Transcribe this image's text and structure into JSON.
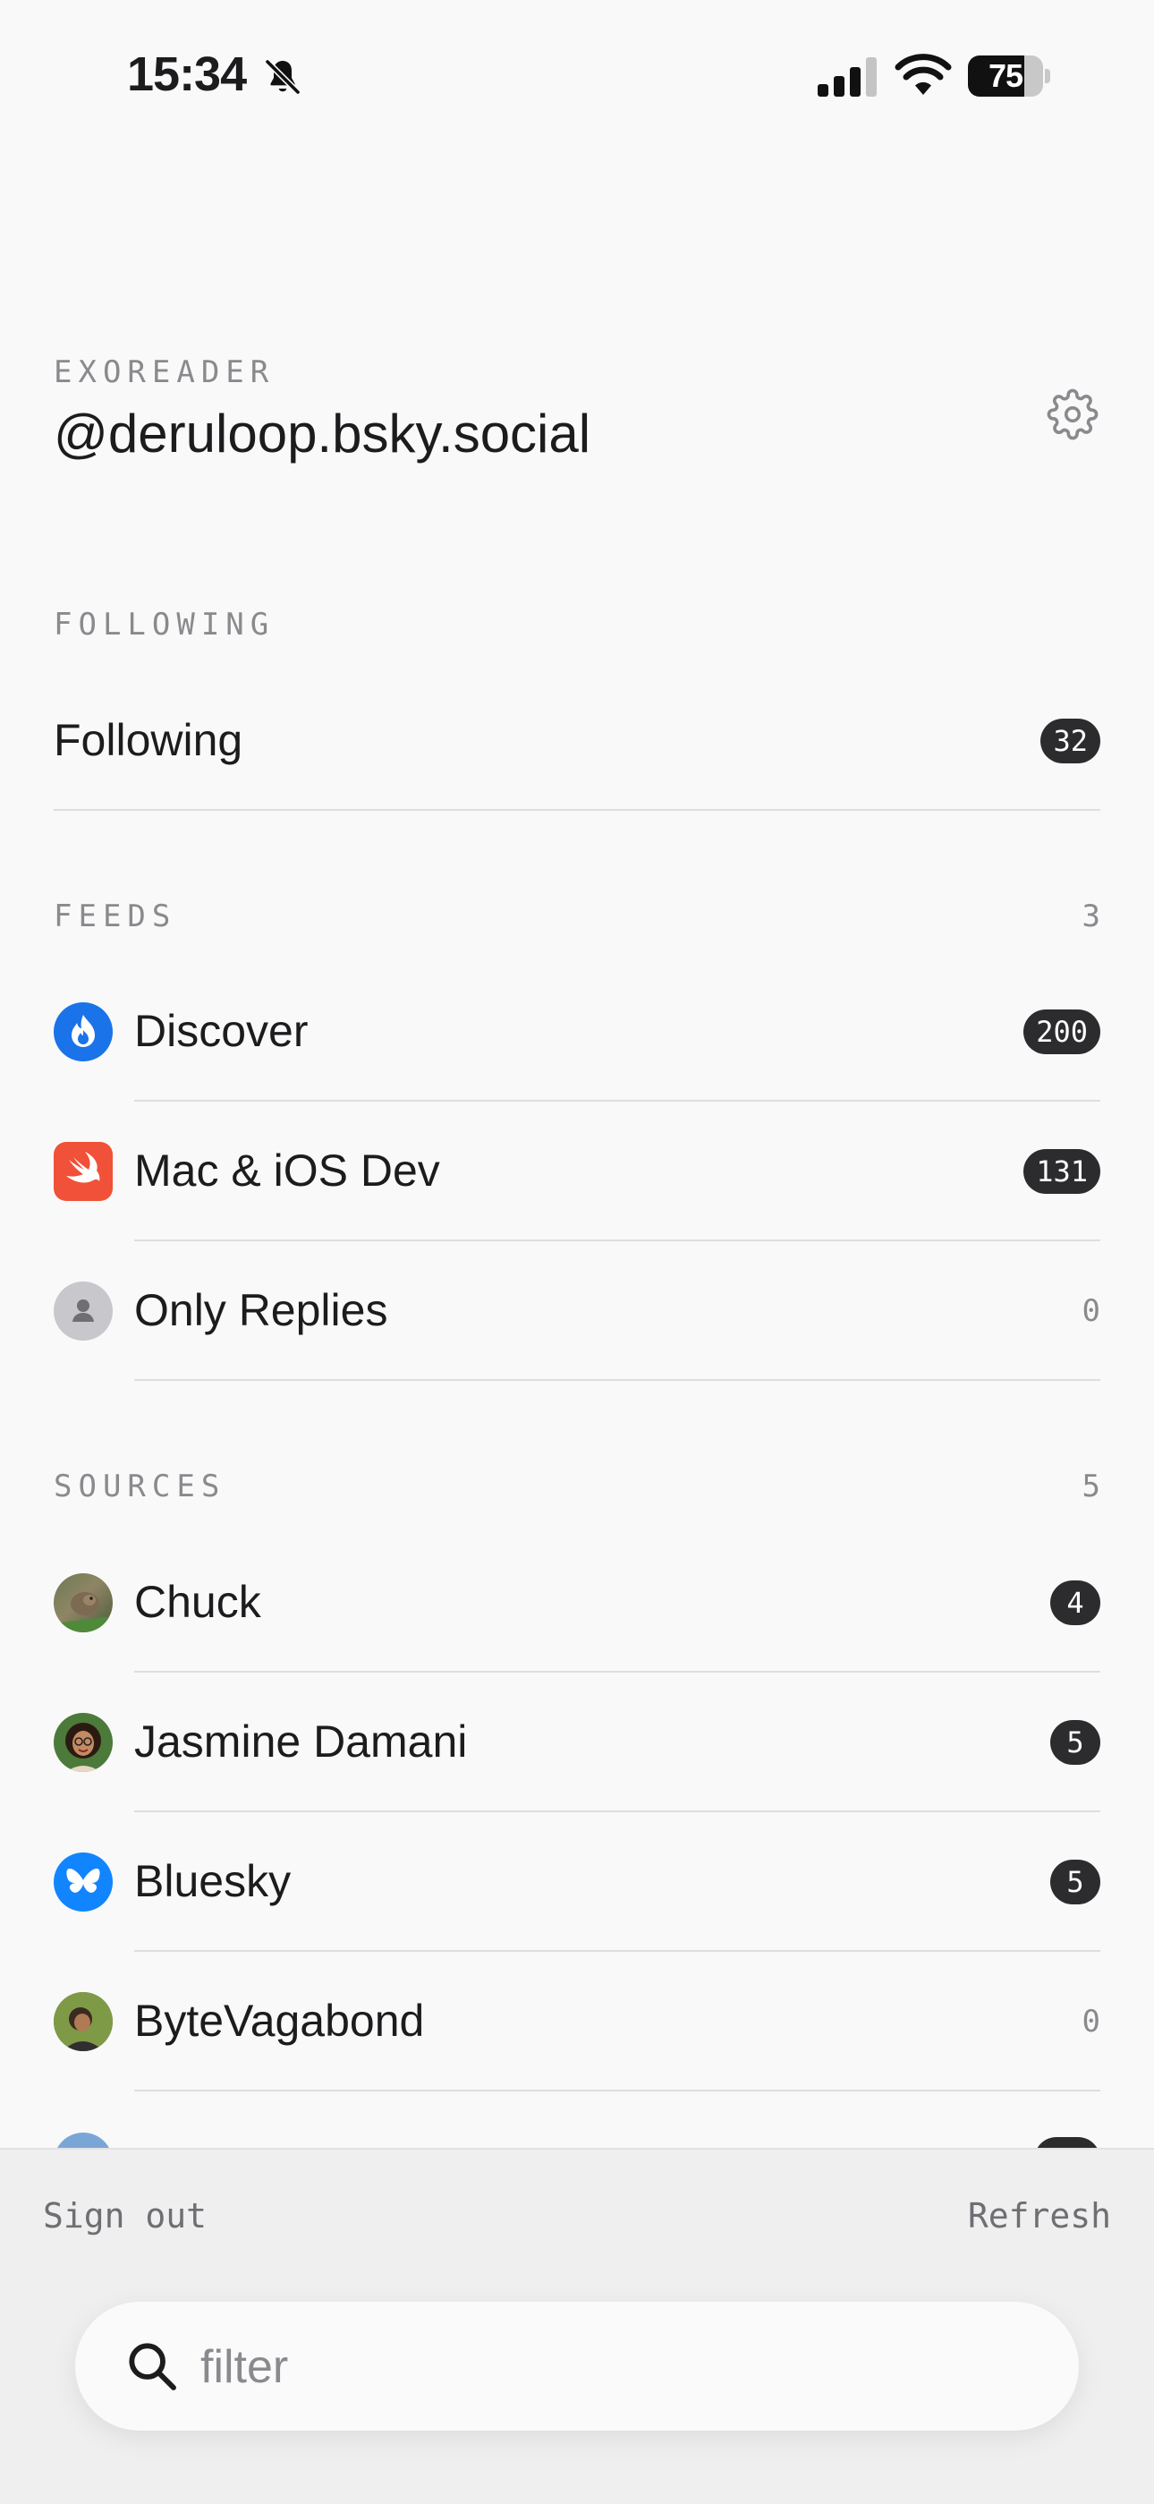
{
  "status_bar": {
    "time": "15:34",
    "battery": "75",
    "battery_level": 0.75,
    "icons": [
      "bell-slash-icon",
      "cellular-signal-icon",
      "wifi-icon",
      "battery-icon"
    ]
  },
  "header": {
    "app_name": "EXOREADER",
    "handle": "@deruloop.bsky.social",
    "settings_icon": "gear-icon"
  },
  "following_section": {
    "label": "FOLLOWING",
    "items": [
      {
        "label": "Following",
        "count": "32"
      }
    ]
  },
  "feeds_section": {
    "label": "FEEDS",
    "count": "3",
    "items": [
      {
        "label": "Discover",
        "count": "200",
        "icon": "discover-flame-icon",
        "color": "#1a73e8"
      },
      {
        "label": "Mac & iOS Dev",
        "count": "131",
        "icon": "swift-icon",
        "color": "#f05138"
      },
      {
        "label": "Only Replies",
        "count": "0",
        "icon": "person-placeholder-icon",
        "color": "#c7c7cc"
      }
    ]
  },
  "sources_section": {
    "label": "SOURCES",
    "count": "5",
    "items": [
      {
        "label": "Chuck",
        "count": "4",
        "icon": "avatar-chuck"
      },
      {
        "label": "Jasmine Damani",
        "count": "5",
        "icon": "avatar-jasmine"
      },
      {
        "label": "Bluesky",
        "count": "5",
        "icon": "bluesky-butterfly-icon",
        "color": "#1185fe"
      },
      {
        "label": "ByteVagabond",
        "count": "0",
        "icon": "avatar-bytevagabond"
      }
    ]
  },
  "bottom_bar": {
    "sign_out": "Sign out",
    "refresh": "Refresh",
    "search_placeholder": "filter"
  }
}
